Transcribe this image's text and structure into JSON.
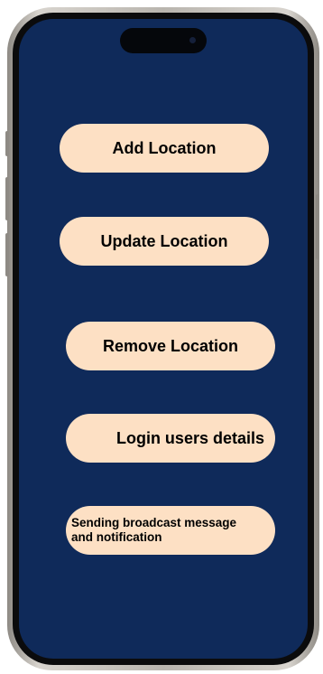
{
  "menu": {
    "add_location": "Add Location",
    "update_location": "Update Location",
    "remove_location": "Remove Location",
    "login_users_details": "Login users details",
    "broadcast": "Sending broadcast message and notification"
  },
  "colors": {
    "screen_background": "#0f2a5a",
    "button_background": "#fde0c4",
    "button_text": "#000000"
  }
}
